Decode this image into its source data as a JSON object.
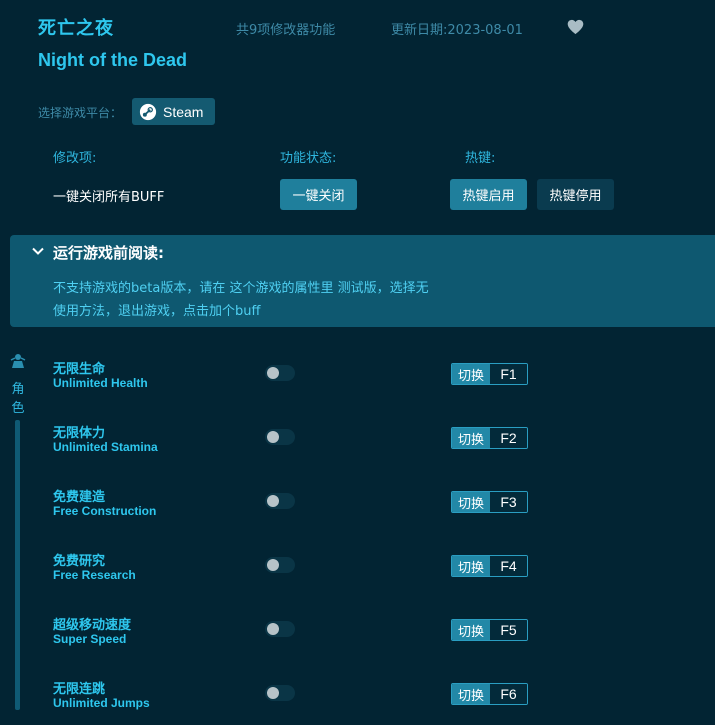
{
  "header": {
    "title_cn": "死亡之夜",
    "feature_count": "共9项修改器功能",
    "update_date": "更新日期:2023-08-01",
    "title_en": "Night of the Dead"
  },
  "platform": {
    "label": "选择游戏平台：",
    "button": "Steam"
  },
  "columns": {
    "item": "修改项:",
    "status": "功能状态:",
    "hotkey": "热键:"
  },
  "global_row": {
    "label": "一键关闭所有BUFF",
    "close_all": "一键关闭",
    "hotkey_enable": "热键启用",
    "hotkey_disable": "热键停用"
  },
  "notice": {
    "title": "运行游戏前阅读:",
    "line1": "不支持游戏的beta版本，请在 这个游戏的属性里 测试版，选择无",
    "line2": "使用方法，退出游戏，点击加个buff"
  },
  "sidebar": {
    "category": "角色"
  },
  "cheats": [
    {
      "name_cn": "无限生命",
      "name_en": "Unlimited Health",
      "switch": "切换",
      "key": "F1"
    },
    {
      "name_cn": "无限体力",
      "name_en": "Unlimited Stamina",
      "switch": "切换",
      "key": "F2"
    },
    {
      "name_cn": "免费建造",
      "name_en": "Free Construction",
      "switch": "切换",
      "key": "F3"
    },
    {
      "name_cn": "免费研究",
      "name_en": "Free Research",
      "switch": "切换",
      "key": "F4"
    },
    {
      "name_cn": "超级移动速度",
      "name_en": "Super Speed",
      "switch": "切换",
      "key": "F5"
    },
    {
      "name_cn": "无限连跳",
      "name_en": "Unlimited Jumps",
      "switch": "切换",
      "key": "F6"
    }
  ]
}
